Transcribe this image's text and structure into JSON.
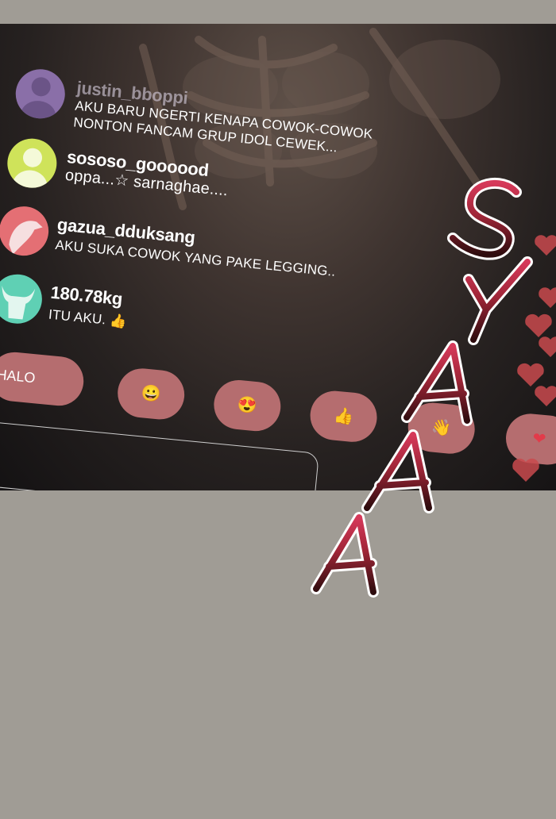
{
  "comments": [
    {
      "username": "justin_bboppi",
      "text_lines": [
        "AKU BARU NGERTI KENAPA COWOK-COWOK",
        "NONTON FANCAM GRUP IDOL CEWEK..."
      ]
    },
    {
      "username": "sososo_goooood",
      "text_lines": [
        "oppa...☆ sarnaghae...."
      ]
    },
    {
      "username": "gazua_dduksang",
      "text_lines": [
        "AKU SUKA COWOK YANG PAKE LEGGING.."
      ]
    },
    {
      "username": "180.78kg",
      "text_lines": [
        "ITU AKU. 👍"
      ]
    }
  ],
  "reactions": {
    "halo_label": "HALO",
    "emojis": [
      "😀",
      "😍",
      "👍",
      "👋",
      "❤"
    ]
  },
  "sound_effect": {
    "letters": [
      "S",
      "Y",
      "A",
      "A",
      "A"
    ],
    "colors": [
      "#d6395a",
      "#b92b44",
      "#8a1f2b",
      "#5a1418",
      "#2e0c0e"
    ]
  },
  "colors": {
    "page_bg": "#a09c95",
    "button": "#b56d6f",
    "heart": "#c94a4e"
  }
}
